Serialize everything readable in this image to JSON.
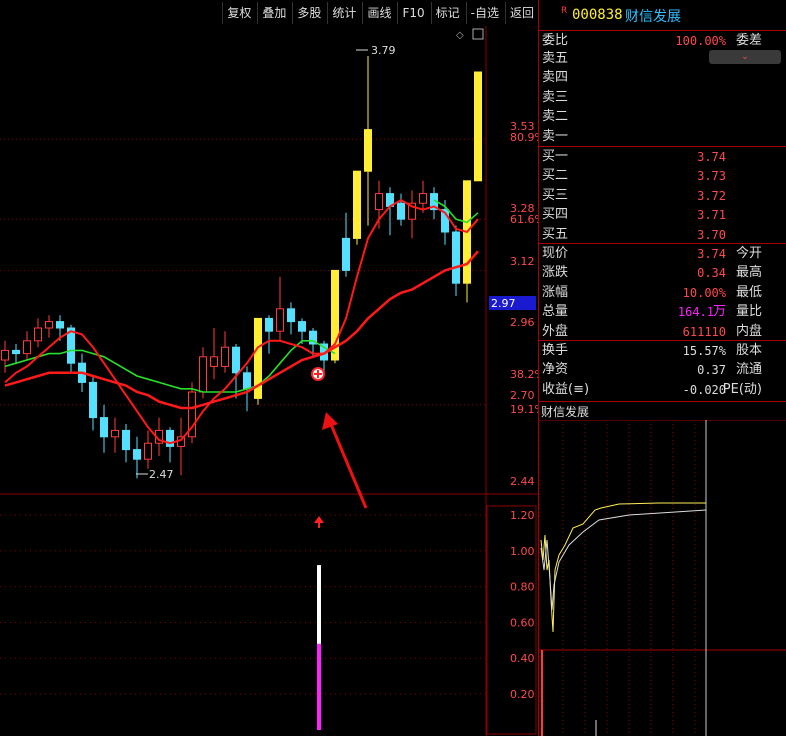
{
  "toolbar": {
    "buttons": [
      "复权",
      "叠加",
      "多股",
      "统计",
      "画线",
      "F10",
      "标记",
      "-自选",
      "返回"
    ]
  },
  "stock": {
    "flag": "R",
    "code": "000838",
    "name": "财信发展"
  },
  "order_ratio": {
    "label": "委比",
    "value": "100.00%",
    "label2": "委差"
  },
  "sell": [
    {
      "label": "卖五",
      "value": ""
    },
    {
      "label": "卖四",
      "value": ""
    },
    {
      "label": "卖三",
      "value": ""
    },
    {
      "label": "卖二",
      "value": ""
    },
    {
      "label": "卖一",
      "value": ""
    }
  ],
  "buy": [
    {
      "label": "买一",
      "value": "3.74"
    },
    {
      "label": "买二",
      "value": "3.73"
    },
    {
      "label": "买三",
      "value": "3.72"
    },
    {
      "label": "买四",
      "value": "3.71"
    },
    {
      "label": "买五",
      "value": "3.70"
    }
  ],
  "quote": [
    {
      "label": "现价",
      "value": "3.74",
      "label2": "今开"
    },
    {
      "label": "涨跌",
      "value": "0.34",
      "label2": "最高"
    },
    {
      "label": "涨幅",
      "value": "10.00%",
      "label2": "最低"
    },
    {
      "label": "总量",
      "value": "164.1",
      "unit": "万",
      "label2": "量比"
    },
    {
      "label": "外盘",
      "value": "611110",
      "label2": "内盘"
    }
  ],
  "stats": [
    {
      "label": "换手",
      "value": "15.57%",
      "label2": "股本"
    },
    {
      "label": "净资",
      "value": "0.37",
      "label2": "流通"
    },
    {
      "label": "收益(≡)",
      "value": "-0.020",
      "label2": "PE(动)"
    }
  ],
  "mini_chart_title": "财信发展",
  "price_axis": {
    "labels": [
      "3.53",
      "80.9%",
      "3.28",
      "61.6%",
      "3.12",
      "2.97",
      "2.96",
      "38.2%",
      "2.70",
      "19.1%",
      "2.44"
    ],
    "current": "2.97"
  },
  "volume_axis": {
    "labels": [
      "1.20",
      "1.00",
      "0.80",
      "0.60",
      "0.40",
      "0.20"
    ]
  },
  "annotations": {
    "high": "3.79",
    "low": "2.47"
  },
  "colors": {
    "up": "#ff3b3b",
    "down": "#55e0ff",
    "highlight": "#ffee33",
    "ma_red": "#ff1a1a",
    "ma_green": "#28e028",
    "grid": "#8a0000",
    "magenta": "#ff22ff"
  },
  "chart_data": {
    "type": "candlestick",
    "y_range": [
      2.44,
      3.79
    ],
    "candles": [
      {
        "o": 2.84,
        "c": 2.87,
        "h": 2.9,
        "l": 2.8,
        "dir": "up"
      },
      {
        "o": 2.87,
        "c": 2.86,
        "h": 2.89,
        "l": 2.83,
        "dir": "down"
      },
      {
        "o": 2.86,
        "c": 2.9,
        "h": 2.93,
        "l": 2.84,
        "dir": "up"
      },
      {
        "o": 2.9,
        "c": 2.94,
        "h": 2.97,
        "l": 2.88,
        "dir": "up"
      },
      {
        "o": 2.94,
        "c": 2.96,
        "h": 2.98,
        "l": 2.91,
        "dir": "up"
      },
      {
        "o": 2.96,
        "c": 2.94,
        "h": 2.98,
        "l": 2.9,
        "dir": "down"
      },
      {
        "o": 2.94,
        "c": 2.83,
        "h": 2.95,
        "l": 2.8,
        "dir": "down"
      },
      {
        "o": 2.83,
        "c": 2.77,
        "h": 2.86,
        "l": 2.74,
        "dir": "down"
      },
      {
        "o": 2.77,
        "c": 2.66,
        "h": 2.79,
        "l": 2.62,
        "dir": "down"
      },
      {
        "o": 2.66,
        "c": 2.6,
        "h": 2.7,
        "l": 2.55,
        "dir": "down"
      },
      {
        "o": 2.6,
        "c": 2.62,
        "h": 2.66,
        "l": 2.55,
        "dir": "up"
      },
      {
        "o": 2.62,
        "c": 2.56,
        "h": 2.64,
        "l": 2.52,
        "dir": "down"
      },
      {
        "o": 2.56,
        "c": 2.53,
        "h": 2.6,
        "l": 2.47,
        "dir": "down"
      },
      {
        "o": 2.53,
        "c": 2.58,
        "h": 2.62,
        "l": 2.5,
        "dir": "up"
      },
      {
        "o": 2.58,
        "c": 2.62,
        "h": 2.66,
        "l": 2.54,
        "dir": "up"
      },
      {
        "o": 2.62,
        "c": 2.57,
        "h": 2.63,
        "l": 2.52,
        "dir": "down"
      },
      {
        "o": 2.57,
        "c": 2.6,
        "h": 2.66,
        "l": 2.48,
        "dir": "up"
      },
      {
        "o": 2.6,
        "c": 2.74,
        "h": 2.77,
        "l": 2.58,
        "dir": "up"
      },
      {
        "o": 2.74,
        "c": 2.85,
        "h": 2.88,
        "l": 2.72,
        "dir": "up"
      },
      {
        "o": 2.85,
        "c": 2.82,
        "h": 2.94,
        "l": 2.78,
        "dir": "up"
      },
      {
        "o": 2.82,
        "c": 2.88,
        "h": 2.93,
        "l": 2.8,
        "dir": "up"
      },
      {
        "o": 2.88,
        "c": 2.8,
        "h": 2.89,
        "l": 2.72,
        "dir": "down"
      },
      {
        "o": 2.8,
        "c": 2.75,
        "h": 2.82,
        "l": 2.68,
        "dir": "down"
      },
      {
        "o": 2.72,
        "c": 2.97,
        "h": 2.97,
        "l": 2.7,
        "dir": "limit"
      },
      {
        "o": 2.97,
        "c": 2.93,
        "h": 2.98,
        "l": 2.86,
        "dir": "down"
      },
      {
        "o": 2.93,
        "c": 3.0,
        "h": 3.1,
        "l": 2.9,
        "dir": "up"
      },
      {
        "o": 3.0,
        "c": 2.96,
        "h": 3.02,
        "l": 2.92,
        "dir": "down"
      },
      {
        "o": 2.96,
        "c": 2.93,
        "h": 2.97,
        "l": 2.89,
        "dir": "down"
      },
      {
        "o": 2.93,
        "c": 2.89,
        "h": 2.94,
        "l": 2.85,
        "dir": "down"
      },
      {
        "o": 2.89,
        "c": 2.84,
        "h": 2.9,
        "l": 2.8,
        "dir": "down"
      },
      {
        "o": 2.84,
        "c": 3.12,
        "h": 3.12,
        "l": 2.83,
        "dir": "limit"
      },
      {
        "o": 3.12,
        "c": 3.22,
        "h": 3.3,
        "l": 3.1,
        "dir": "down"
      },
      {
        "o": 3.22,
        "c": 3.43,
        "h": 3.43,
        "l": 3.2,
        "dir": "limit"
      },
      {
        "o": 3.43,
        "c": 3.56,
        "h": 3.79,
        "l": 3.26,
        "dir": "limit"
      },
      {
        "o": 3.31,
        "c": 3.36,
        "h": 3.4,
        "l": 3.25,
        "dir": "up"
      },
      {
        "o": 3.36,
        "c": 3.32,
        "h": 3.38,
        "l": 3.23,
        "dir": "down"
      },
      {
        "o": 3.33,
        "c": 3.28,
        "h": 3.36,
        "l": 3.26,
        "dir": "down"
      },
      {
        "o": 3.28,
        "c": 3.33,
        "h": 3.37,
        "l": 3.22,
        "dir": "up"
      },
      {
        "o": 3.33,
        "c": 3.36,
        "h": 3.4,
        "l": 3.3,
        "dir": "up"
      },
      {
        "o": 3.36,
        "c": 3.31,
        "h": 3.38,
        "l": 3.28,
        "dir": "down"
      },
      {
        "o": 3.31,
        "c": 3.24,
        "h": 3.34,
        "l": 3.2,
        "dir": "down"
      },
      {
        "o": 3.24,
        "c": 3.08,
        "h": 3.26,
        "l": 3.04,
        "dir": "down"
      },
      {
        "o": 3.08,
        "c": 3.4,
        "h": 3.4,
        "l": 3.02,
        "dir": "limit"
      },
      {
        "o": 3.4,
        "c": 3.74,
        "h": 3.74,
        "l": 3.4,
        "dir": "limit"
      }
    ],
    "ma_red": [
      2.77,
      2.8,
      2.82,
      2.85,
      2.88,
      2.91,
      2.93,
      2.92,
      2.88,
      2.83,
      2.78,
      2.73,
      2.68,
      2.63,
      2.59,
      2.58,
      2.59,
      2.63,
      2.68,
      2.72,
      2.75,
      2.79,
      2.83,
      2.88,
      2.9,
      2.9,
      2.89,
      2.88,
      2.86,
      2.86,
      2.89,
      2.97,
      3.1,
      3.22,
      3.28,
      3.32,
      3.34,
      3.32,
      3.31,
      3.32,
      3.3,
      3.25,
      3.24,
      3.28
    ],
    "ma_red_slow": [
      2.76,
      2.77,
      2.78,
      2.79,
      2.8,
      2.8,
      2.8,
      2.8,
      2.79,
      2.78,
      2.77,
      2.76,
      2.74,
      2.73,
      2.71,
      2.7,
      2.69,
      2.69,
      2.7,
      2.71,
      2.72,
      2.73,
      2.74,
      2.76,
      2.78,
      2.8,
      2.82,
      2.84,
      2.85,
      2.86,
      2.88,
      2.9,
      2.93,
      2.97,
      3.0,
      3.03,
      3.05,
      3.06,
      3.08,
      3.1,
      3.12,
      3.13,
      3.14,
      3.18
    ],
    "ma_green": [
      2.82,
      2.83,
      2.84,
      2.85,
      2.86,
      2.86,
      2.87,
      2.87,
      2.86,
      2.85,
      2.83,
      2.81,
      2.79,
      2.78,
      2.77,
      2.76,
      2.75,
      2.75,
      2.74,
      2.74,
      2.74,
      2.74,
      2.75,
      2.76,
      2.79,
      2.83,
      2.87,
      2.9,
      2.9,
      2.88,
      2.86,
      null,
      null,
      null,
      null,
      null,
      null,
      null,
      null,
      3.34,
      3.32,
      3.28,
      3.27,
      3.3
    ],
    "volume": {
      "bar_top": 0.92,
      "bar_mid": 0.48,
      "label_axis": [
        1.2,
        0.2
      ]
    }
  }
}
